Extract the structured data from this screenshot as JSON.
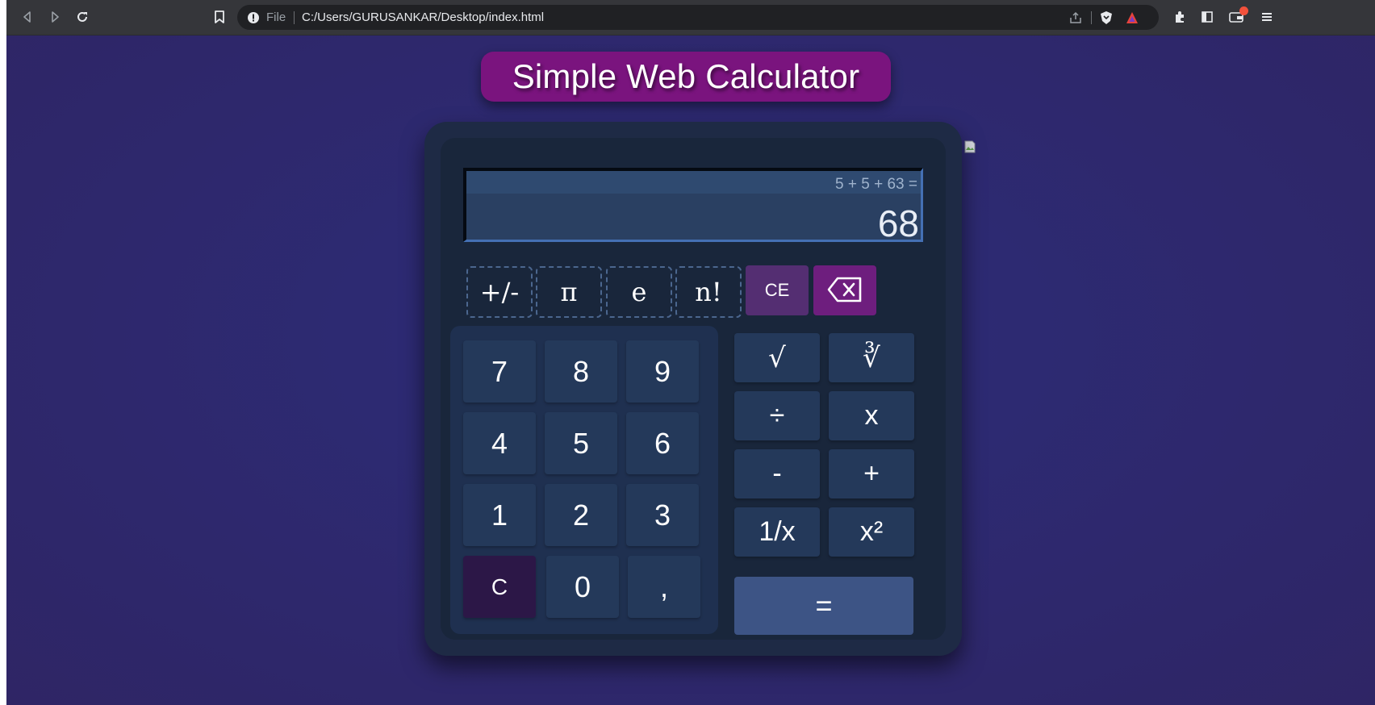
{
  "browser": {
    "url_scheme_label": "File",
    "url": "C:/Users/GURUSANKAR/Desktop/index.html"
  },
  "page": {
    "title": "Simple Web Calculator"
  },
  "display": {
    "expression": "5 + 5 + 63 =",
    "result": "68"
  },
  "function_keys": {
    "negate": "+/-",
    "pi": "π",
    "e": "e",
    "factorial": "n!",
    "clear_entry": "CE"
  },
  "numpad": {
    "seven": "7",
    "eight": "8",
    "nine": "9",
    "four": "4",
    "five": "5",
    "six": "6",
    "one": "1",
    "two": "2",
    "three": "3",
    "clear": "C",
    "zero": "0",
    "comma": ","
  },
  "operators": {
    "sqrt": "√",
    "cbrt": "∛",
    "divide": "÷",
    "multiply": "x",
    "subtract": "-",
    "add": "+",
    "reciprocal": "1/x",
    "square": "x²",
    "equals": "="
  },
  "colors": {
    "page_background": "#2d2a72",
    "title_pill": "#7a147e",
    "calculator_body": "#1e2a45",
    "key": "#24395a",
    "clear_entry": "#542e72",
    "backspace": "#6e1e7e",
    "clear": "#2c1747",
    "equals": "#3d5485"
  },
  "icons": {
    "backspace": "backspace-icon"
  }
}
